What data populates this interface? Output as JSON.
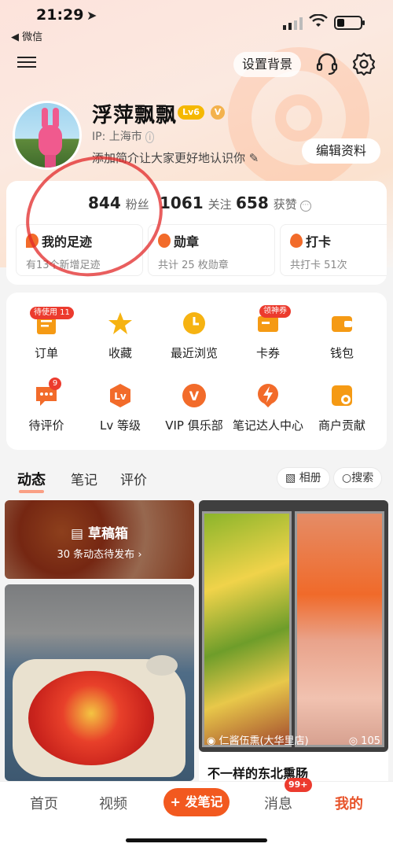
{
  "status_bar": {
    "time": "21:29",
    "back_app": "◀ 微信"
  },
  "header": {
    "set_background": "设置背景"
  },
  "profile": {
    "nickname": "浮萍飘飘",
    "level": "Lv6",
    "vip_mark": "V",
    "ip": "IP: 上海市",
    "bio": "添加简介让大家更好地认识你",
    "edit_button": "编辑资料"
  },
  "stats": [
    {
      "value": "844",
      "label": "粉丝"
    },
    {
      "value": "1061",
      "label": "关注"
    },
    {
      "value": "658",
      "label": "获赞"
    }
  ],
  "mini_cards": [
    {
      "title": "我的足迹",
      "sub": "有13个新增足迹"
    },
    {
      "title": "勋章",
      "sub": "共计 25 枚勋章"
    },
    {
      "title": "打卡",
      "sub": "共打卡 51次"
    }
  ],
  "grid": [
    {
      "label": "订单",
      "badge": "待使用 11",
      "icon": "order-icon",
      "color": "#f59a14"
    },
    {
      "label": "收藏",
      "icon": "star-icon",
      "color": "#f6b312"
    },
    {
      "label": "最近浏览",
      "icon": "clock-icon",
      "color": "#f6b312"
    },
    {
      "label": "卡券",
      "badge": "领神券",
      "icon": "coupon-icon",
      "color": "#f59a14"
    },
    {
      "label": "钱包",
      "icon": "wallet-icon",
      "color": "#f59a14"
    },
    {
      "label": "待评价",
      "badge": "9",
      "icon": "comment-icon",
      "color": "#f26b2a"
    },
    {
      "label": "Lv 等级",
      "icon": "level-icon",
      "color": "#f26b2a"
    },
    {
      "label": "VIP 俱乐部",
      "icon": "vip-icon",
      "color": "#f26b2a"
    },
    {
      "label": "笔记达人中心",
      "icon": "bolt-icon",
      "color": "#f26b2a"
    },
    {
      "label": "商户贡献",
      "icon": "shop-icon",
      "color": "#f59a14"
    }
  ],
  "tabs": [
    "动态",
    "笔记",
    "评价"
  ],
  "tab_tools": {
    "album": "相册",
    "search": "搜索"
  },
  "feed": {
    "draft_title": "草稿箱",
    "draft_sub": "30 条动态待发布",
    "post_location": "仁酱伍熏(大华里店)",
    "post_views": "105",
    "post_title": "不一样的东北熏肠"
  },
  "bottom_nav": {
    "home": "首页",
    "video": "视频",
    "post": "+ 发笔记",
    "message": "消息",
    "message_badge": "99+",
    "me": "我的"
  }
}
